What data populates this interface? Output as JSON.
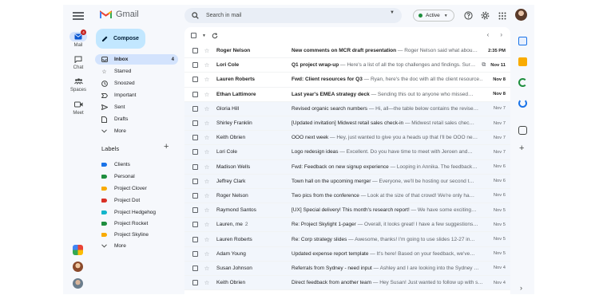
{
  "app": {
    "name": "Gmail"
  },
  "rail": {
    "items": [
      {
        "label": "Mail",
        "badge": "4"
      },
      {
        "label": "Chat"
      },
      {
        "label": "Spaces"
      },
      {
        "label": "Meet"
      }
    ]
  },
  "compose": {
    "label": "Compose"
  },
  "nav": {
    "items": [
      {
        "label": "Inbox",
        "count": "4",
        "icon": "inbox-icon"
      },
      {
        "label": "Starred",
        "icon": "star-icon"
      },
      {
        "label": "Snoozed",
        "icon": "clock-icon"
      },
      {
        "label": "Important",
        "icon": "important-icon"
      },
      {
        "label": "Sent",
        "icon": "send-icon"
      },
      {
        "label": "Drafts",
        "icon": "draft-icon"
      },
      {
        "label": "More",
        "icon": "chevron-down-icon"
      }
    ]
  },
  "labels": {
    "title": "Labels",
    "items": [
      {
        "label": "Clients",
        "color": "#1a73e8"
      },
      {
        "label": "Personal",
        "color": "#1e8e3e"
      },
      {
        "label": "Project Clover",
        "color": "#f9ab00"
      },
      {
        "label": "Project Dot",
        "color": "#d93025"
      },
      {
        "label": "Project Hedgehog",
        "color": "#12b5cb"
      },
      {
        "label": "Project Rocket",
        "color": "#1e8e3e"
      },
      {
        "label": "Project Skyline",
        "color": "#f9ab00"
      }
    ],
    "more": "More"
  },
  "search": {
    "placeholder": "Search in mail"
  },
  "status": {
    "label": "Active",
    "color": "#1e8e3e"
  },
  "emails": [
    {
      "sender": "Roger Nelson",
      "subject": "New comments on MCR draft presentation",
      "preview": " — Roger Nelson said what abou…",
      "date": "2:35 PM",
      "unread": true
    },
    {
      "sender": "Lori Cole",
      "subject": "Q1 project wrap-up",
      "preview": " — Here's a list of all the top challenges and findings. Sur…",
      "date": "Nov 11",
      "unread": true,
      "attachment": true
    },
    {
      "sender": "Lauren Roberts",
      "subject": "Fwd: Client resources for Q3",
      "preview": " — Ryan, here's the doc with all the client resource…",
      "date": "Nov 8",
      "unread": true
    },
    {
      "sender": "Ethan Lattimore",
      "subject": "Last year's EMEA strategy deck",
      "preview": " — Sending this out to anyone who missed…",
      "date": "Nov 8",
      "unread": true
    },
    {
      "sender": "Gloria Hill",
      "subject": "Revised organic search numbers",
      "preview": " — Hi, all—the table below contains the revise…",
      "date": "Nov 7",
      "unread": false
    },
    {
      "sender": "Shirley Franklin",
      "subject": "[Updated invitation] Midwest retail sales check-in",
      "preview": " — Midwest retail sales chec…",
      "date": "Nov 7",
      "unread": false
    },
    {
      "sender": "Keith Obrien",
      "subject": "OOO next week",
      "preview": " — Hey, just wanted to give you a heads up that I'll be OOO ne…",
      "date": "Nov 7",
      "unread": false
    },
    {
      "sender": "Lori Cole",
      "subject": "Logo redesign ideas",
      "preview": " — Excellent. Do you have time to meet with Jeroen and…",
      "date": "Nov 7",
      "unread": false
    },
    {
      "sender": "Madison Wells",
      "subject": "Fwd: Feedback on new signup experience",
      "preview": " — Looping in Annika. The feedback…",
      "date": "Nov 6",
      "unread": false
    },
    {
      "sender": "Jeffrey Clark",
      "subject": "Town hall on the upcoming merger",
      "preview": " — Everyone, we'll be hosting our second t…",
      "date": "Nov 6",
      "unread": false
    },
    {
      "sender": "Roger Nelson",
      "subject": "Two pics from the conference",
      "preview": " — Look at the size of that crowd! We're only ha…",
      "date": "Nov 6",
      "unread": false
    },
    {
      "sender": "Raymond Santos",
      "subject": "[UX] Special delivery! This month's research report!",
      "preview": " — We have some exciting…",
      "date": "Nov 5",
      "unread": false
    },
    {
      "sender": "Lauren, me",
      "count": "2",
      "subject": "Re: Project Skylight 1-pager",
      "preview": " — Overall, it looks great! I have a few suggestions…",
      "date": "Nov 5",
      "unread": false
    },
    {
      "sender": "Lauren Roberts",
      "subject": "Re: Corp strategy slides",
      "preview": " — Awesome, thanks! I'm going to use slides 12-27 in…",
      "date": "Nov 5",
      "unread": false
    },
    {
      "sender": "Adam Young",
      "subject": "Updated expense report template",
      "preview": " — It's here! Based on your feedback, we've…",
      "date": "Nov 5",
      "unread": false
    },
    {
      "sender": "Susan Johnson",
      "subject": "Referrals from Sydney - need input",
      "preview": " — Ashley and I are looking into the Sydney …",
      "date": "Nov 4",
      "unread": false
    },
    {
      "sender": "Keith Obrien",
      "subject": "Direct feedback from another team",
      "preview": " — Hey Susan! Just wanted to follow up with s…",
      "date": "Nov 4",
      "unread": false
    }
  ],
  "side_panel": [
    {
      "icon": "calendar-icon",
      "color": "#1a73e8"
    },
    {
      "icon": "keep-icon",
      "color": "#f9ab00"
    },
    {
      "icon": "phone-icon",
      "color": "#1e8e3e"
    },
    {
      "icon": "tasks-icon",
      "color": "#1a73e8"
    }
  ]
}
